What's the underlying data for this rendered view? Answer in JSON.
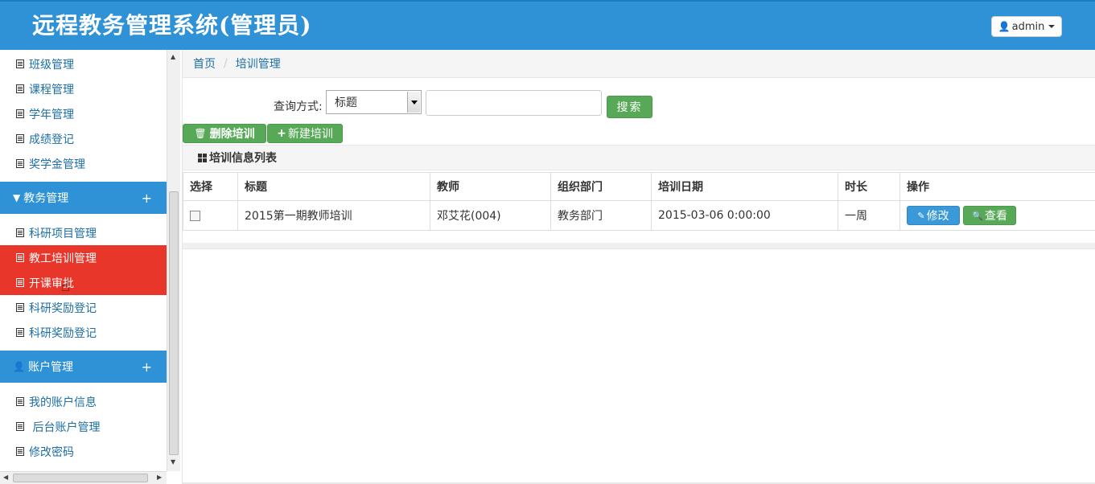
{
  "header": {
    "title": "远程教务管理系统(管理员)",
    "user_label": "admin",
    "user_icon": "user-icon"
  },
  "sidebar": {
    "items_top": [
      {
        "label": "班级管理"
      },
      {
        "label": "课程管理"
      },
      {
        "label": "学年管理"
      },
      {
        "label": "成绩登记"
      },
      {
        "label": "奖学金管理"
      }
    ],
    "group_academic": {
      "label": "教务管理",
      "icon": "filter-icon",
      "toggle": "+"
    },
    "items_academic": [
      {
        "label": "科研项目管理"
      },
      {
        "label": "教工培训管理"
      },
      {
        "label": "开课审批"
      },
      {
        "label": "科研奖励登记"
      },
      {
        "label": "科研奖励登记"
      }
    ],
    "group_account": {
      "label": "账户管理",
      "icon": "user-icon",
      "toggle": "+"
    },
    "items_account": [
      {
        "label": "我的账户信息"
      },
      {
        "label": " 后台账户管理"
      },
      {
        "label": "修改密码"
      }
    ]
  },
  "breadcrumb": {
    "home": "首页",
    "sep": "/",
    "current": "培训管理"
  },
  "search": {
    "label": "查询方式:",
    "selected": "标题",
    "value": "",
    "button": "搜索"
  },
  "actions": {
    "delete_label": "删除培训",
    "new_label": "新建培训"
  },
  "panel": {
    "title": "培训信息列表"
  },
  "table": {
    "columns": [
      "选择",
      "标题",
      "教师",
      "组织部门",
      "培训日期",
      "时长",
      "操作"
    ],
    "rows": [
      {
        "title": "2015第一期教师培训",
        "teacher": "邓艾花(004)",
        "department": "教务部门",
        "date": "2015-03-06 0:00:00",
        "duration": "一周",
        "edit_label": "修改",
        "view_label": "查看"
      }
    ]
  },
  "colors": {
    "header_bg": "#2f92d6",
    "active_item": "#e8372a",
    "green_button": "#57a957",
    "blue_button": "#3a9ad9",
    "link": "#1c6ea4"
  }
}
